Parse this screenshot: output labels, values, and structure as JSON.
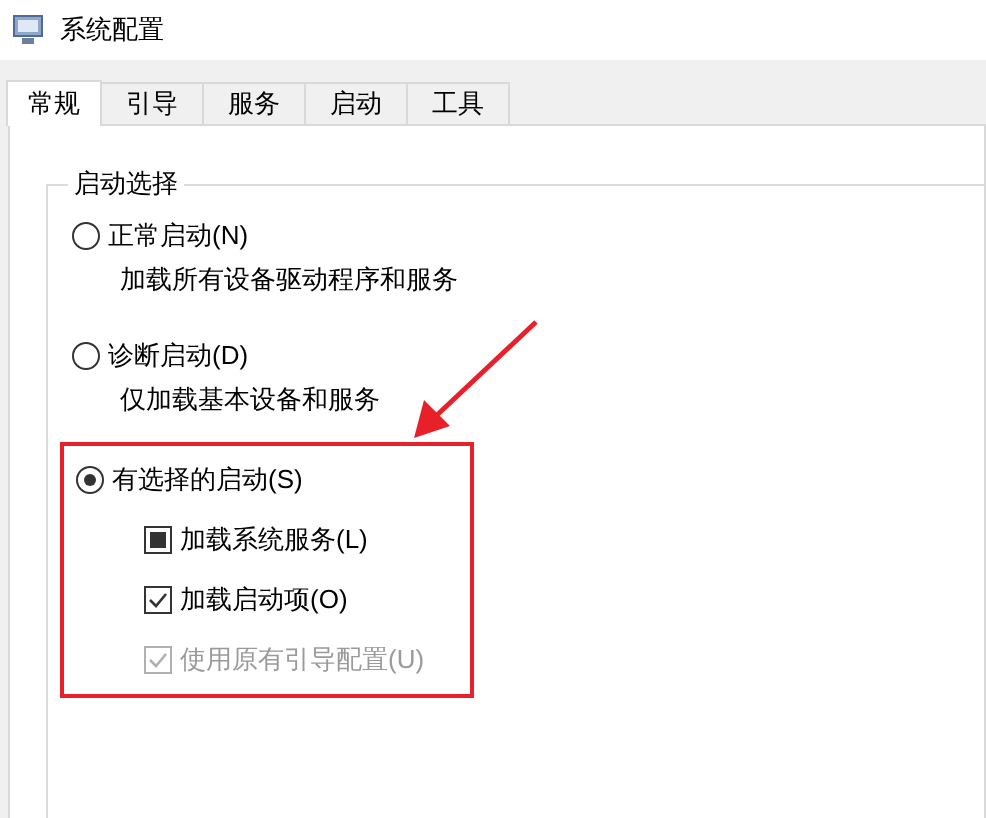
{
  "window": {
    "title": "系统配置"
  },
  "tabs": [
    {
      "label": "常规",
      "selected": true
    },
    {
      "label": "引导",
      "selected": false
    },
    {
      "label": "服务",
      "selected": false
    },
    {
      "label": "启动",
      "selected": false
    },
    {
      "label": "工具",
      "selected": false
    }
  ],
  "group": {
    "title": "启动选择",
    "options": [
      {
        "label": "正常启动(N)",
        "description": "加载所有设备驱动程序和服务",
        "selected": false
      },
      {
        "label": "诊断启动(D)",
        "description": "仅加载基本设备和服务",
        "selected": false
      },
      {
        "label": "有选择的启动(S)",
        "selected": true,
        "highlighted": true,
        "suboptions": [
          {
            "label": "加载系统服务(L)",
            "checked": true,
            "indeterminate": true,
            "disabled": false
          },
          {
            "label": "加载启动项(O)",
            "checked": true,
            "disabled": false
          },
          {
            "label": "使用原有引导配置(U)",
            "checked": true,
            "disabled": true
          }
        ]
      }
    ]
  }
}
